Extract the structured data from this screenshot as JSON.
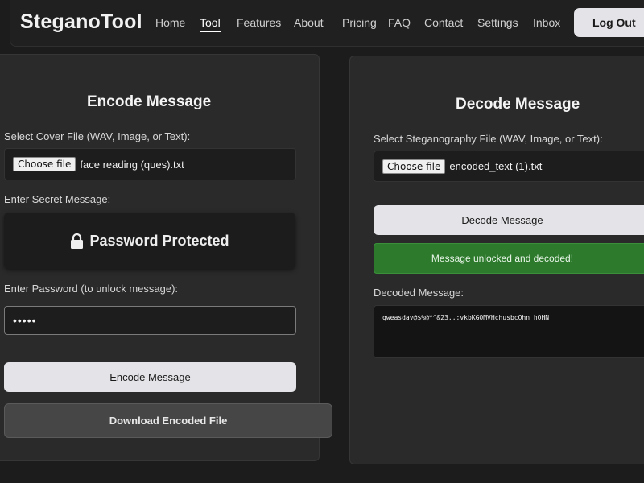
{
  "header": {
    "brand": "SteganoTool",
    "nav": [
      {
        "label": "Home"
      },
      {
        "label": "Tool"
      },
      {
        "label": "Features"
      },
      {
        "label": "About"
      },
      {
        "label": "Pricing"
      },
      {
        "label": "FAQ"
      },
      {
        "label": "Contact"
      },
      {
        "label": "Settings"
      },
      {
        "label": "Inbox"
      }
    ],
    "active_nav": "Tool",
    "logout_label": "Log Out"
  },
  "encode": {
    "title": "Encode Message",
    "cover_label": "Select Cover File (WAV, Image, or Text):",
    "choose_label": "Choose file",
    "cover_file": "face reading (ques).txt",
    "secret_label": "Enter Secret Message:",
    "protected_text": "Password Protected",
    "password_label": "Enter Password (to unlock message):",
    "password_value": "•••••",
    "encode_button": "Encode Message",
    "download_button": "Download Encoded File"
  },
  "decode": {
    "title": "Decode Message",
    "file_label": "Select Steganography File (WAV, Image, or Text):",
    "choose_label": "Choose file",
    "file_name": "encoded_text (1).txt",
    "decode_button": "Decode Message",
    "status": "Message unlocked and decoded!",
    "decoded_label": "Decoded Message:",
    "decoded_text": "qweasdav@$%@*^&23.,;vkbKGOMVHchusbcOhn hOHN"
  },
  "colors": {
    "background": "#1c1c1c",
    "panel": "#2a2a2a",
    "success": "#2d7a2d",
    "button_light": "#e4e4e8"
  }
}
